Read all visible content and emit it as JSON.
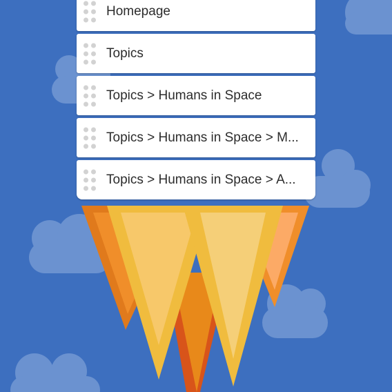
{
  "colors": {
    "sky": "#3d6fbf",
    "cloud": "#6b92d0",
    "card_bg": "#ffffff",
    "card_text": "#2c2c2c",
    "grip_dot": "#d2d2d2",
    "flame_dark_orange": "#e07a1c",
    "flame_orange": "#f08e2a",
    "flame_yellow": "#f0bc3e",
    "flame_light": "#f7cf72",
    "flame_red": "#d8541a"
  },
  "breadcrumb_cards": [
    {
      "label": "Homepage",
      "icon": "drag-handle-icon"
    },
    {
      "label": "Topics",
      "icon": "drag-handle-icon"
    },
    {
      "label": "Topics > Humans in Space",
      "icon": "drag-handle-icon"
    },
    {
      "label": "Topics > Humans in Space > M...",
      "icon": "drag-handle-icon"
    },
    {
      "label": "Topics > Humans in Space > A...",
      "icon": "drag-handle-icon"
    }
  ]
}
